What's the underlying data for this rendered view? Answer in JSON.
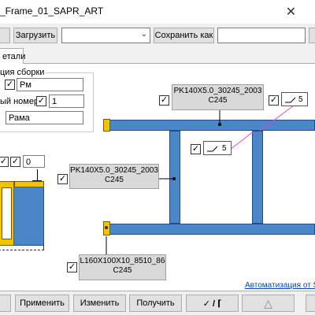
{
  "window": {
    "title": "_Frame_01_SAPR_ART",
    "close_glyph": "✕"
  },
  "toolbar": {
    "left_btn": "",
    "load_button": "Загрузить",
    "preset_combo_value": "",
    "save_as_button": "Сохранить как",
    "save_as_field": "",
    "right_btn": ""
  },
  "tabs": [
    {
      "label": "етали"
    }
  ],
  "assembly": {
    "group_title": "ция сборки",
    "prefix_value": "Рм",
    "number_label": "ый номер:",
    "number_value": "1",
    "name_value": "Рама"
  },
  "drawing": {
    "left_offset_value": "0",
    "profile_top": {
      "line1": "PK140X5.0_30245_2003",
      "line2": "C245"
    },
    "profile_mid": {
      "line1": "PK140X5.0_30245_2003",
      "line2": "C245"
    },
    "profile_bottom": {
      "line1": "L160X100X10_8510_86",
      "line2": "C245"
    },
    "weld_top": "5",
    "weld_mid": "5",
    "checkmark": "✓",
    "automation_link": "Автоматизация от SAP"
  },
  "bottom": {
    "apply_button": "Применить",
    "change_button": "Изменить",
    "get_button": "Получить",
    "toggle_button": "✓ / ⌈",
    "warn_button": "△"
  }
}
